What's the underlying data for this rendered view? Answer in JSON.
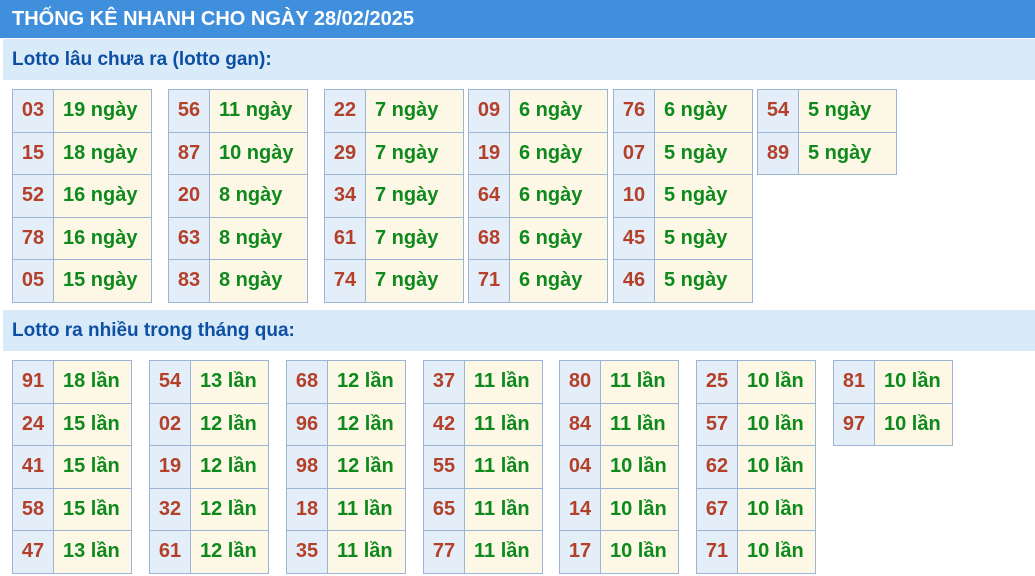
{
  "header": {
    "title": "THỐNG KÊ NHANH CHO NGÀY 28/02/2025"
  },
  "gan": {
    "title": "Lotto lâu chưa ra (lotto gan):",
    "columns": [
      [
        {
          "num": "03",
          "val": "19 ngày"
        },
        {
          "num": "15",
          "val": "18 ngày"
        },
        {
          "num": "52",
          "val": "16 ngày"
        },
        {
          "num": "78",
          "val": "16 ngày"
        },
        {
          "num": "05",
          "val": "15 ngày"
        }
      ],
      [
        {
          "num": "56",
          "val": "11 ngày"
        },
        {
          "num": "87",
          "val": "10 ngày"
        },
        {
          "num": "20",
          "val": "8 ngày"
        },
        {
          "num": "63",
          "val": "8 ngày"
        },
        {
          "num": "83",
          "val": "8 ngày"
        }
      ],
      [
        {
          "num": "22",
          "val": "7 ngày"
        },
        {
          "num": "29",
          "val": "7 ngày"
        },
        {
          "num": "34",
          "val": "7 ngày"
        },
        {
          "num": "61",
          "val": "7 ngày"
        },
        {
          "num": "74",
          "val": "7 ngày"
        }
      ],
      [
        {
          "num": "09",
          "val": "6 ngày"
        },
        {
          "num": "19",
          "val": "6 ngày"
        },
        {
          "num": "64",
          "val": "6 ngày"
        },
        {
          "num": "68",
          "val": "6 ngày"
        },
        {
          "num": "71",
          "val": "6 ngày"
        }
      ],
      [
        {
          "num": "76",
          "val": "6 ngày"
        },
        {
          "num": "07",
          "val": "5 ngày"
        },
        {
          "num": "10",
          "val": "5 ngày"
        },
        {
          "num": "45",
          "val": "5 ngày"
        },
        {
          "num": "46",
          "val": "5 ngày"
        }
      ],
      [
        {
          "num": "54",
          "val": "5 ngày"
        },
        {
          "num": "89",
          "val": "5 ngày"
        }
      ]
    ]
  },
  "frequent": {
    "title": "Lotto ra nhiều trong tháng qua:",
    "columns": [
      [
        {
          "num": "91",
          "val": "18 lần"
        },
        {
          "num": "24",
          "val": "15 lần"
        },
        {
          "num": "41",
          "val": "15 lần"
        },
        {
          "num": "58",
          "val": "15 lần"
        },
        {
          "num": "47",
          "val": "13 lần"
        }
      ],
      [
        {
          "num": "54",
          "val": "13 lần"
        },
        {
          "num": "02",
          "val": "12 lần"
        },
        {
          "num": "19",
          "val": "12 lần"
        },
        {
          "num": "32",
          "val": "12 lần"
        },
        {
          "num": "61",
          "val": "12 lần"
        }
      ],
      [
        {
          "num": "68",
          "val": "12 lần"
        },
        {
          "num": "96",
          "val": "12 lần"
        },
        {
          "num": "98",
          "val": "12 lần"
        },
        {
          "num": "18",
          "val": "11 lần"
        },
        {
          "num": "35",
          "val": "11 lần"
        }
      ],
      [
        {
          "num": "37",
          "val": "11 lần"
        },
        {
          "num": "42",
          "val": "11 lần"
        },
        {
          "num": "55",
          "val": "11 lần"
        },
        {
          "num": "65",
          "val": "11 lần"
        },
        {
          "num": "77",
          "val": "11 lần"
        }
      ],
      [
        {
          "num": "80",
          "val": "11 lần"
        },
        {
          "num": "84",
          "val": "11 lần"
        },
        {
          "num": "04",
          "val": "10 lần"
        },
        {
          "num": "14",
          "val": "10 lần"
        },
        {
          "num": "17",
          "val": "10 lần"
        }
      ],
      [
        {
          "num": "25",
          "val": "10 lần"
        },
        {
          "num": "57",
          "val": "10 lần"
        },
        {
          "num": "62",
          "val": "10 lần"
        },
        {
          "num": "67",
          "val": "10 lần"
        },
        {
          "num": "71",
          "val": "10 lần"
        }
      ],
      [
        {
          "num": "81",
          "val": "10 lần"
        },
        {
          "num": "97",
          "val": "10 lần"
        }
      ]
    ]
  }
}
